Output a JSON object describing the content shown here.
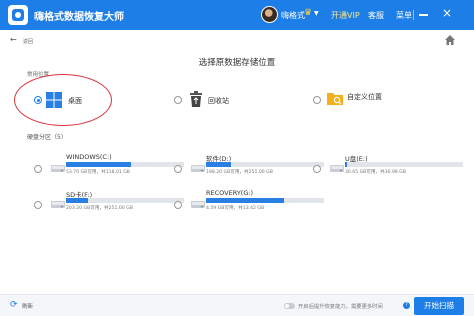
{
  "titlebar": {
    "title": "嗨格式数据恢复大师",
    "username": "嗨格式",
    "vip_label": "开通VIP",
    "service_label": "客服",
    "menu_label": "菜单",
    "minimize_icon": "minimize-icon",
    "close_glyph": "×"
  },
  "header": {
    "back_label": "返回",
    "back_glyph": "←",
    "page_title": "选择原数据存储位置"
  },
  "locations": {
    "section_label": "常用位置",
    "items": [
      {
        "label": "桌面",
        "icon": "windows-desktop-icon",
        "selected": true
      },
      {
        "label": "回收站",
        "icon": "recycle-bin-icon",
        "selected": false
      },
      {
        "label": "自定义位置",
        "icon": "folder-search-icon",
        "selected": false
      }
    ]
  },
  "disks": {
    "section_label": "硬盘分区（5）",
    "items": [
      {
        "name": "WINDOWS(C:)",
        "size": "53.70 GB可用，共118.01 GB",
        "used_fraction": 0.55
      },
      {
        "name": "软件(D:)",
        "size": "198.20 GB可用，共251.00 GB",
        "used_fraction": 0.21
      },
      {
        "name": "U盘(E:)",
        "size": "30.65 GB可用，共30.98 GB",
        "used_fraction": 0.02
      },
      {
        "name": "SD卡(F:)",
        "size": "203.20 GB可用，共251.00 GB",
        "used_fraction": 0.19
      },
      {
        "name": "RECOVERY(G:)",
        "size": "4.59 GB可用，共13.42 GB",
        "used_fraction": 0.66
      }
    ]
  },
  "bottom": {
    "refresh_label": "刷新",
    "refresh_glyph": "⟳",
    "deep_scan_label": "开启后提升恢复能力，需要更多时间",
    "help_glyph": "?",
    "scan_label": "开始扫描"
  },
  "colors": {
    "accent": "#1e7ee8",
    "highlight": "#d9363e"
  }
}
